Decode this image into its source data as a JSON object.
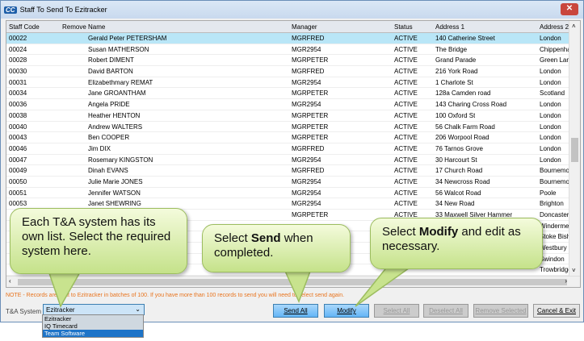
{
  "window": {
    "title": "Staff To Send To Ezitracker",
    "logo": "CC"
  },
  "columns": [
    "Staff Code",
    "Remove",
    "Name",
    "Manager",
    "Status",
    "Address 1",
    "Address 2"
  ],
  "rows": [
    [
      "00022",
      "",
      "Gerald Peter PETERSHAM",
      "MGRFRED",
      "ACTIVE",
      "140 Catherine Street",
      "London"
    ],
    [
      "00024",
      "",
      "Susan MATHERSON",
      "MGR2954",
      "ACTIVE",
      "The Bridge",
      "Chippenham"
    ],
    [
      "00028",
      "",
      "Robert DIMENT",
      "MGRPETER",
      "ACTIVE",
      "Grand Parade",
      "Green Lane"
    ],
    [
      "00030",
      "",
      "David BARTON",
      "MGRFRED",
      "ACTIVE",
      "216 York Road",
      "London"
    ],
    [
      "00031",
      "",
      "Elizabethmary REMAT",
      "MGR2954",
      "ACTIVE",
      "1 Charlote St",
      "London"
    ],
    [
      "00034",
      "",
      "Jane GROANTHAM",
      "MGRPETER",
      "ACTIVE",
      "128a Camden road",
      "Scotland"
    ],
    [
      "00036",
      "",
      "Angela PRIDE",
      "MGR2954",
      "ACTIVE",
      "143 Charing Cross Road",
      "London"
    ],
    [
      "00038",
      "",
      "Heather HENTON",
      "MGRPETER",
      "ACTIVE",
      "100 Oxford St",
      "London"
    ],
    [
      "00040",
      "",
      "Andrew WALTERS",
      "MGRPETER",
      "ACTIVE",
      "56 Chalk Farm Road",
      "London"
    ],
    [
      "00043",
      "",
      "Ben COOPER",
      "MGRPETER",
      "ACTIVE",
      "206 Worpool Road",
      "London"
    ],
    [
      "00046",
      "",
      "Jim DIX",
      "MGRFRED",
      "ACTIVE",
      "76 Tarnos Grove",
      "London"
    ],
    [
      "00047",
      "",
      "Rosemary KINGSTON",
      "MGR2954",
      "ACTIVE",
      "30 Harcourt St",
      "London"
    ],
    [
      "00049",
      "",
      "Dinah EVANS",
      "MGRFRED",
      "ACTIVE",
      "17 Church Road",
      "Bournemouth"
    ],
    [
      "00050",
      "",
      "Julie Marie JONES",
      "MGR2954",
      "ACTIVE",
      "34 Newcross Road",
      "Bournemouth"
    ],
    [
      "00051",
      "",
      "Jennifer WATSON",
      "MGR2954",
      "ACTIVE",
      "56 Walcot Road",
      "Poole"
    ],
    [
      "00053",
      "",
      "Janet SHEWRING",
      "MGR2954",
      "ACTIVE",
      "34 New Road",
      "Brighton"
    ],
    [
      "",
      "",
      "",
      "MGRPETER",
      "ACTIVE",
      "33 Maxwell Silver Hammer",
      "Doncaster"
    ],
    [
      "",
      "",
      "",
      "",
      "",
      "",
      "Windermere"
    ],
    [
      "",
      "",
      "",
      "",
      "",
      "",
      "Stoke Bish"
    ],
    [
      "",
      "",
      "",
      "",
      "",
      "",
      "Westbury"
    ],
    [
      "",
      "",
      "",
      "",
      "",
      "",
      "Swindon"
    ],
    [
      "",
      "",
      "",
      "",
      "",
      "",
      "Trowbridge"
    ]
  ],
  "note": "NOTE - Records are sent to Ezitracker in batches of 100. If you have more than 100 records to send you will need to select send again.",
  "ta_system": {
    "label": "T&A System",
    "value": "Ezitracker",
    "options": [
      "Ezitracker",
      "IQ Timecard",
      "Team Software"
    ],
    "highlighted": "Team Software"
  },
  "buttons": {
    "send_all": "Send All",
    "modify": "Modify",
    "select_all": "Select All",
    "deselect_all": "Deselect All",
    "remove_selected": "Remove Selected",
    "cancel_exit": "Cancel & Exit"
  },
  "callouts": {
    "system": "Each T&A system has its own list. Select the required system here.",
    "send_pre": "Select ",
    "send_bold": "Send",
    "send_post": " when completed.",
    "modify_pre": "Select ",
    "modify_bold": "Modify",
    "modify_post": " and edit as necessary."
  },
  "colors": {
    "accent": "#64b5f6",
    "selected_row": "#b9e6f7",
    "note": "#e8741e",
    "callout": "#c5e28a"
  }
}
